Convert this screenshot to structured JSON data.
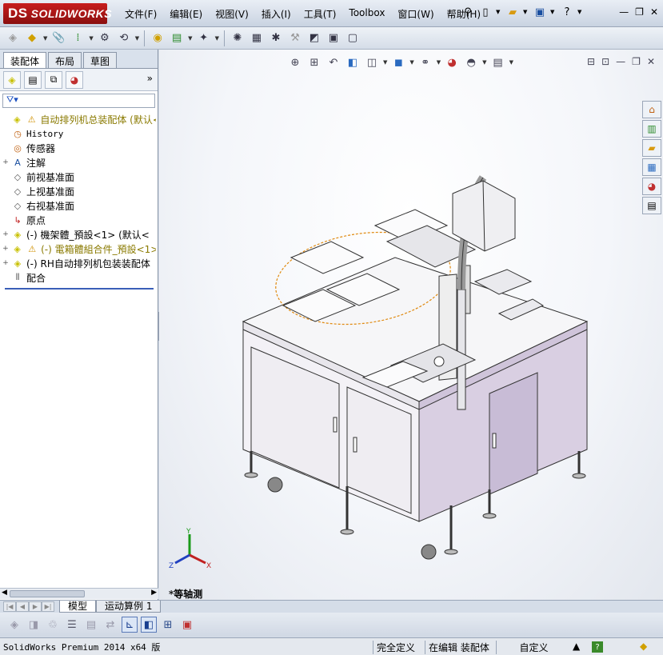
{
  "app": {
    "logo_text": "SOLIDWORKS",
    "logo_mark": "DS"
  },
  "menu": [
    "文件(F)",
    "编辑(E)",
    "视图(V)",
    "插入(I)",
    "工具(T)",
    "Toolbox",
    "窗口(W)",
    "帮助(H)"
  ],
  "quick_access": {
    "pin_icon": "pin-icon",
    "new_icon": "new-document-icon",
    "open_icon": "open-folder-icon",
    "save_icon": "save-icon",
    "help_label": "?"
  },
  "feature_manager": {
    "tabs": [
      "装配体",
      "布局",
      "草图"
    ],
    "active_tab": "装配体",
    "more": "»",
    "filter_icon": "filter-icon",
    "tree": [
      {
        "label": "自动排列机总装配体  (默认<",
        "icon": "assembly-icon",
        "warn": true,
        "expand": "",
        "root": true
      },
      {
        "label": "History",
        "icon": "history-icon",
        "expand": "",
        "mono": true
      },
      {
        "label": "传感器",
        "icon": "sensor-icon",
        "expand": ""
      },
      {
        "label": "注解",
        "icon": "annotation-icon",
        "expand": "+"
      },
      {
        "label": "前视基准面",
        "icon": "plane-icon",
        "expand": ""
      },
      {
        "label": "上视基准面",
        "icon": "plane-icon",
        "expand": ""
      },
      {
        "label": "右视基准面",
        "icon": "plane-icon",
        "expand": ""
      },
      {
        "label": "原点",
        "icon": "origin-icon",
        "expand": ""
      },
      {
        "label": "(-) 機架體_預設<1> (默认<",
        "icon": "part-icon",
        "expand": "+"
      },
      {
        "label": "(-) 電箱體組合件_預設<1>",
        "icon": "part-icon",
        "warn": true,
        "expand": "+"
      },
      {
        "label": "(-) RH自动排列机包装装配体",
        "icon": "part-icon",
        "expand": "+"
      },
      {
        "label": "配合",
        "icon": "mates-icon",
        "expand": ""
      }
    ]
  },
  "viewport": {
    "view_label": "*等轴测",
    "triad": {
      "x": "X",
      "y": "Y",
      "z": "Z"
    }
  },
  "bottom_tabs": [
    "模型",
    "运动算例 1"
  ],
  "active_bottom_tab": "模型",
  "status": {
    "product": "SolidWorks Premium 2014 x64 版",
    "definition": "完全定义",
    "editing": "在编辑 装配体",
    "units": "自定义",
    "help": "?"
  },
  "colors": {
    "accent": "#3a5fb8",
    "logo": "#b31818",
    "warning": "#f0c000",
    "assembly_yellow": "#d8d800"
  }
}
